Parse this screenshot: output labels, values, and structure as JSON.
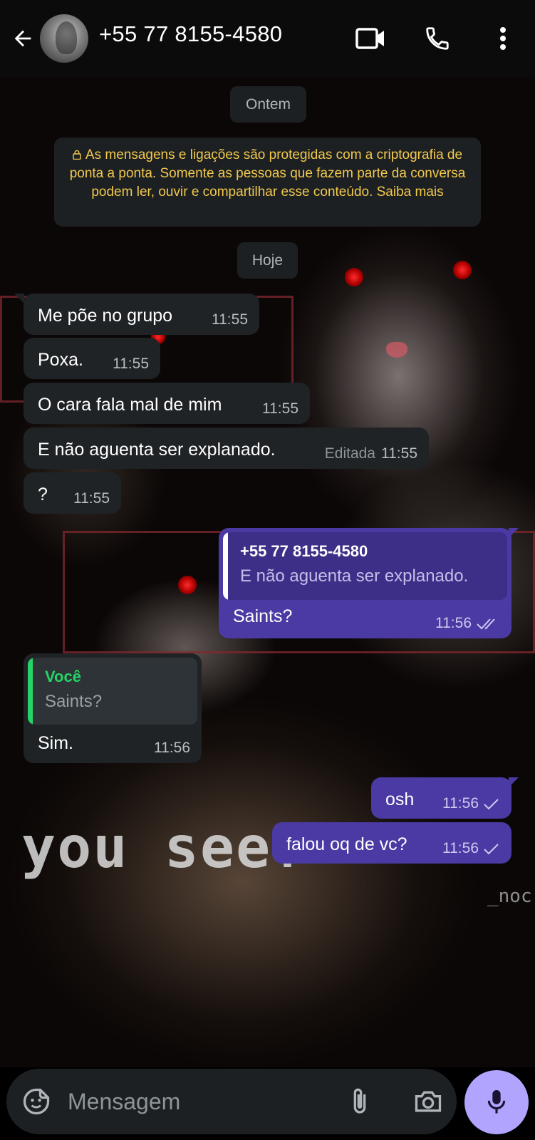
{
  "header": {
    "contact_name": "+55 77 8155-4580",
    "icons": [
      "back-arrow-icon",
      "video-call-icon",
      "voice-call-icon",
      "more-options-icon"
    ]
  },
  "chat": {
    "date_yesterday": "Ontem",
    "encryption_notice": "As mensagens e ligações são protegidas com a criptografia de ponta a ponta. Somente as pessoas que fazem parte da conversa podem ler, ouvir e compartilhar esse conteúdo. Saiba mais",
    "date_today": "Hoje",
    "messages": [
      {
        "direction": "in",
        "text": "Me põe no grupo",
        "time": "11:55"
      },
      {
        "direction": "in",
        "text": "Poxa.",
        "time": "11:55"
      },
      {
        "direction": "in",
        "text": "O cara fala mal de mim",
        "time": "11:55"
      },
      {
        "direction": "in",
        "text": "E não aguenta ser explanado.",
        "edited": "Editada",
        "time": "11:55"
      },
      {
        "direction": "in",
        "text": "?",
        "time": "11:55"
      },
      {
        "direction": "out",
        "quote_author": "+55 77 8155-4580",
        "quote_text": "E não aguenta ser explanado.",
        "text": "Saints?",
        "time": "11:56",
        "status": "read"
      },
      {
        "direction": "in",
        "quote_author": "Você",
        "quote_text": "Saints?",
        "text": "Sim.",
        "time": "11:56"
      },
      {
        "direction": "out",
        "text": "osh",
        "time": "11:56",
        "status": "sent"
      },
      {
        "direction": "out",
        "text": "falou oq de vc?",
        "time": "11:56",
        "status": "sent"
      }
    ]
  },
  "wallpaper": {
    "caption": "you see?",
    "watermark": "_noc"
  },
  "composer": {
    "placeholder": "Mensagem",
    "icons": [
      "sticker-icon",
      "attach-icon",
      "camera-icon",
      "mic-icon"
    ]
  },
  "colors": {
    "incoming_bubble": "#1f2326",
    "outgoing_bubble": "#4b3aa3",
    "mic_button": "#b0a4ff",
    "notice_text": "#f2c94c",
    "quote_bar_out": "#ffffff",
    "quote_bar_in": "#25d366"
  }
}
